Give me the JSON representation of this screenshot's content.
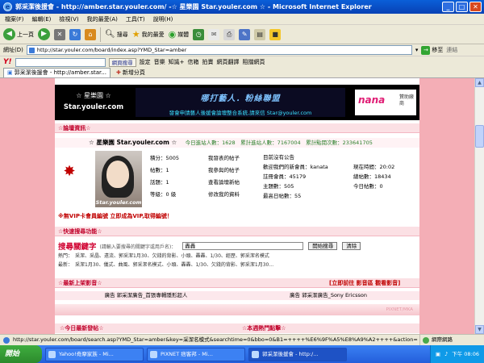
{
  "window": {
    "title": "郭采潔後援會 - http://amber.star.youler.com/ -☆ 星樂園 Star.youler.com ☆ - Microsoft Internet Explorer",
    "ie_icon": "ie-logo-icon",
    "min": "_",
    "max": "□",
    "close": "✕"
  },
  "menu": [
    "檔案(F)",
    "編輯(E)",
    "檢視(V)",
    "我的最愛(A)",
    "工具(T)",
    "說明(H)"
  ],
  "toolbar": {
    "back": "上一頁",
    "forward_icon": "forward-icon",
    "search": "搜尋",
    "favorites": "我的最愛",
    "media": "媒體"
  },
  "address": {
    "label": "網址(D)",
    "url": "http://star.youler.com/board/index.asp?YMD_Star=amber",
    "go": "移至",
    "links": "連結"
  },
  "yahoo": {
    "logo": "Y!",
    "search": "網頁搜尋",
    "items": [
      "設定",
      "音樂",
      "知識+",
      "信箱",
      "拍賣",
      "網頁翻譯",
      "阻擋網頁"
    ]
  },
  "tabs": {
    "active": "郭采潔後援會 - http://amber.star...",
    "new_tab": "新增分頁"
  },
  "banner": {
    "logo_cn": "☆ 星樂園 ☆",
    "logo_en": "Star.youler.com",
    "slogan": "哪打藝人．粉絲聯盟",
    "recruit": "發會申請藝人後援會論壇整合系統,請來信 Star@youler.com",
    "nana": "nana",
    "sponsor": "贊助廠商"
  },
  "sections": {
    "forum_info": "☆論壇資訊☆",
    "vip": "※無VIP卡會員編號 立即成為VIP,取得編號！",
    "quick_search": "☆快速搜尋功能☆",
    "latest_ads": "☆最新上架影音☆",
    "ads_right": "[立即前往 影音區 觀看影音]",
    "today_posts": "☆今日最新發帖☆",
    "week_hot": "☆本週熱門點擊☆"
  },
  "info": {
    "title": "☆ 星樂園 Star.youler.com ☆",
    "stats": "今日進站人數：1628　累計進站人數：7167004　累計點閱次數：233641705"
  },
  "profile": {
    "signature": "Star.youler.com",
    "col1": [
      "積分：5005",
      "帖數：1",
      "話題：1",
      "等級：0 級"
    ],
    "col2": [
      "我發表的帖子",
      "我參與的帖子",
      "查看論壇新帖",
      "修改我的資料"
    ],
    "col3": [
      "目前沒有公告",
      "歡迎我們的新會員：kanata",
      "註冊會員：45179",
      "主題數：505",
      "最高日帖數：55"
    ],
    "col4": [
      "現在時間：20:02",
      "總帖數：18434",
      "今日帖數：0"
    ]
  },
  "search": {
    "title": "搜尋關鍵字",
    "hint": "(請輸入要搜尋的關鍵字或用戶名)：",
    "value": "轟轟",
    "btn_start": "開始搜尋",
    "btn_clear": "清除"
  },
  "keywords": {
    "hot": "熱門：　采潔、采晶、遠流、郭采潔1月30、欠錢的背影、小頭、轟轟、1/30、經歷、郭采潔名模式",
    "latest": "最新：　采潔1月30、儀式、曲風、郭采潔名模式、小頭、轟轟、1/30、欠錢的背影、郭采潔1月30..."
  },
  "ads": {
    "left": "廣告 郭采潔廣告_首張專輯隱形超人",
    "right": "廣告 郭采潔廣告_Sony Ericsson"
  },
  "pixnet_brand": "PIXNET/MKA",
  "status": {
    "url": "http://star.youler.com/board/search.asp?YMD_Star=amber&key=采潔名模式&searchtime=0&bbo=0&B1=++++%E6%9F%A5%E8%A9%A2++++&action=",
    "zone": "網際網路"
  },
  "taskbar": {
    "start": "開始",
    "tasks": [
      "Yahoo!奇摩家族 - Mi...",
      "PIXNET 痞客邦 - Mi...",
      "郭采潔後援會 - http:/..."
    ],
    "clock": "下午 08:06"
  }
}
